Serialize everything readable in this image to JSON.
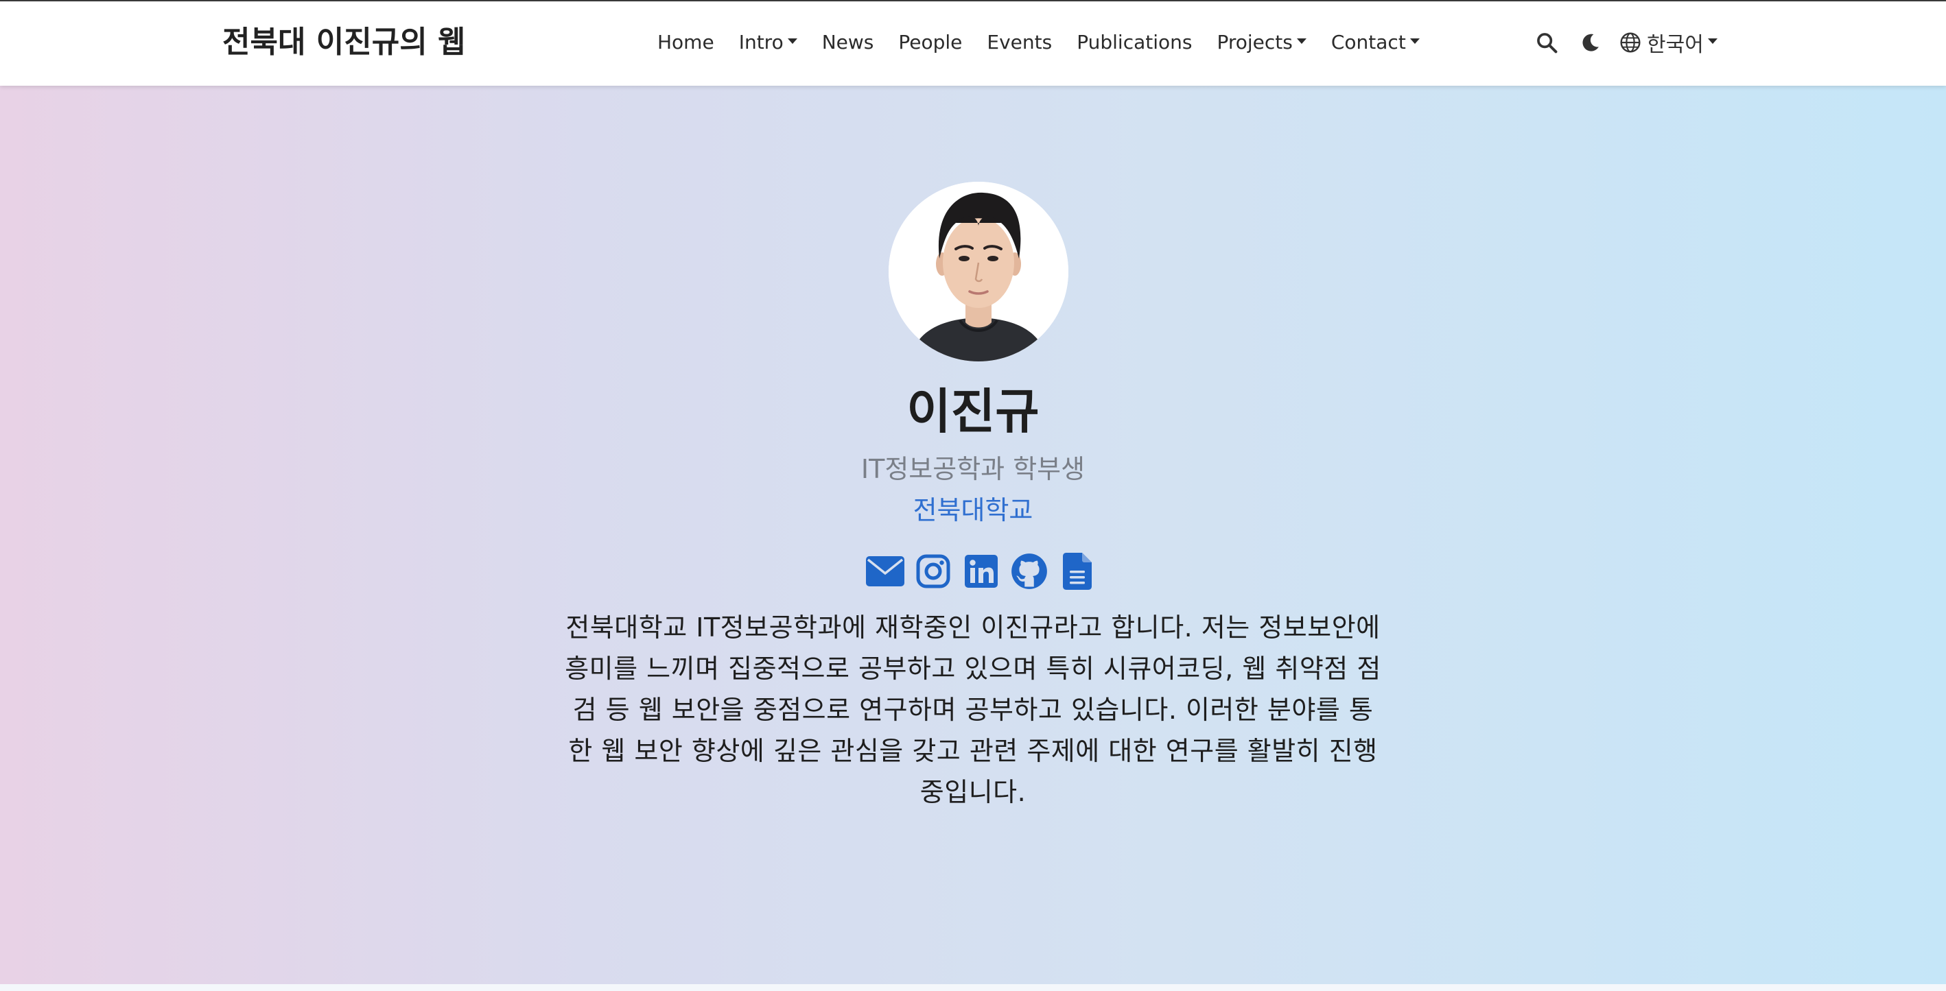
{
  "site": {
    "brand": "전북대 이진규의 웹"
  },
  "nav": {
    "items": [
      {
        "label": "Home",
        "dropdown": false
      },
      {
        "label": "Intro",
        "dropdown": true
      },
      {
        "label": "News",
        "dropdown": false
      },
      {
        "label": "People",
        "dropdown": false
      },
      {
        "label": "Events",
        "dropdown": false
      },
      {
        "label": "Publications",
        "dropdown": false
      },
      {
        "label": "Projects",
        "dropdown": true
      },
      {
        "label": "Contact",
        "dropdown": true
      }
    ]
  },
  "tools": {
    "search_icon": "search-icon",
    "theme_icon": "moon-icon",
    "language_icon": "globe-icon",
    "language_label": "한국어"
  },
  "profile": {
    "name": "이진규",
    "role": "IT정보공학과 학부생",
    "organization": "전북대학교",
    "socials": [
      "email-icon",
      "instagram-icon",
      "linkedin-icon",
      "github-icon",
      "cv-document-icon"
    ],
    "bio": "전북대학교 IT정보공학과에 재학중인 이진규라고 합니다. 저는 정보보안에 흥미를 느끼며 집중적으로 공부하고 있으며 특히 시큐어코딩, 웹 취약점 점검 등 웹 보안을 중점으로 연구하며 공부하고 있습니다. 이러한 분야를 통한 웹 보안 향상에 깊은 관심을 갖고 관련 주제에 대한 연구를 활발히 진행중입니다."
  },
  "colors": {
    "accent": "#2f6fd0",
    "icon_blue": "#1f66c8",
    "gradient_left": "#e8d2e6",
    "gradient_right": "#c5e6f8"
  }
}
